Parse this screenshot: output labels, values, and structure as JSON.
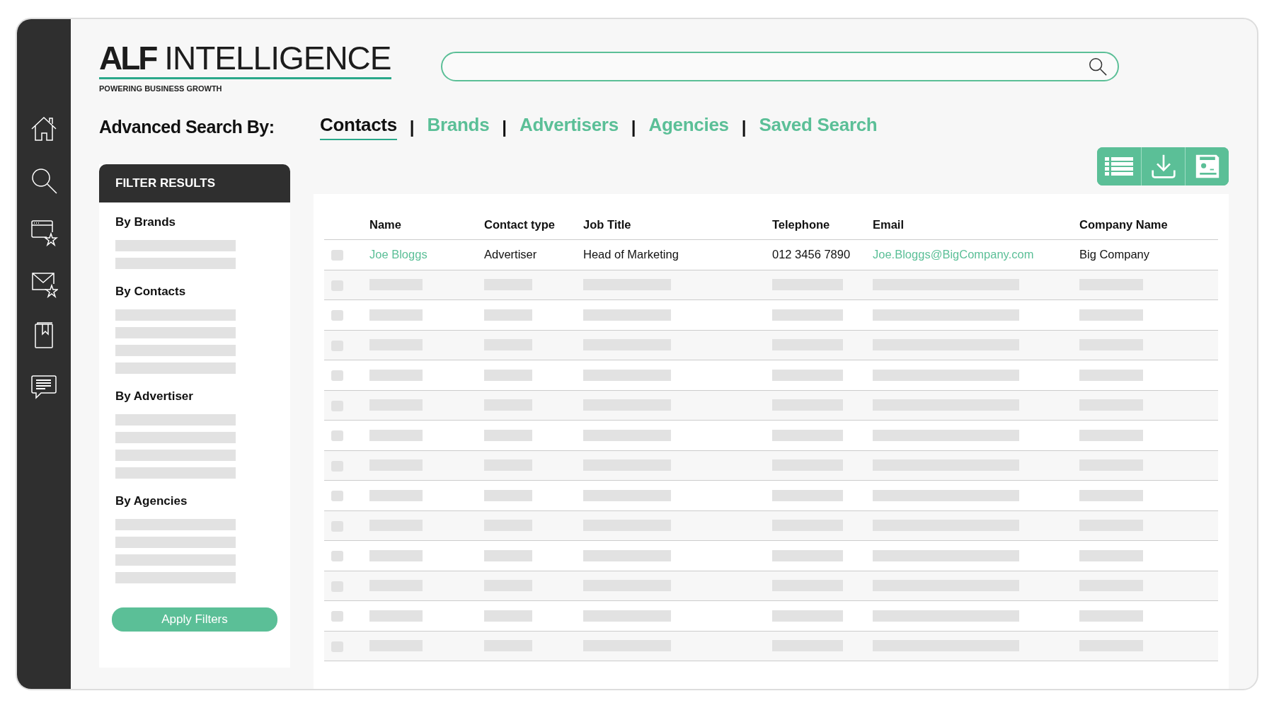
{
  "logo": {
    "brand_bold": "ALF",
    "brand_light": "INTELLIGENCE",
    "tagline": "POWERING BUSINESS GROWTH"
  },
  "advanced_search": {
    "label": "Advanced Search By:",
    "tabs": [
      {
        "label": "Contacts",
        "selected": true
      },
      {
        "label": "Brands",
        "selected": false
      },
      {
        "label": "Advertisers",
        "selected": false
      },
      {
        "label": "Agencies",
        "selected": false
      },
      {
        "label": "Saved Search",
        "selected": false
      }
    ],
    "separator": "|"
  },
  "filters": {
    "title": "FILTER RESULTS",
    "groups": [
      {
        "heading": "By Brands",
        "options": [
          {
            "kind": "placeholder"
          },
          {
            "kind": "placeholder"
          }
        ]
      },
      {
        "heading": "By Contacts",
        "options": [
          {
            "kind": "placeholder"
          },
          {
            "kind": "placeholder"
          },
          {
            "kind": "placeholder"
          },
          {
            "kind": "placeholder"
          }
        ]
      },
      {
        "heading": "By Advertiser",
        "options": [
          {
            "kind": "placeholder"
          },
          {
            "kind": "placeholder"
          },
          {
            "kind": "placeholder"
          },
          {
            "kind": "placeholder"
          }
        ]
      },
      {
        "heading": "By Agencies",
        "options": [
          {
            "kind": "placeholder"
          },
          {
            "kind": "placeholder"
          },
          {
            "kind": "placeholder"
          },
          {
            "kind": "placeholder"
          }
        ]
      }
    ],
    "apply_button": "Apply Filters"
  },
  "table": {
    "columns": [
      "Name",
      "Contact type",
      "Job Title",
      "Telephone",
      "Email",
      "Company Name"
    ],
    "rows": [
      {
        "kind": "contact",
        "checked": false,
        "name": "Joe Bloggs",
        "contact_type": "Advertiser",
        "job_title": "Head of Marketing",
        "telephone": "012 3456 7890",
        "email": "Joe.Bloggs@BigCompany.com",
        "company": "Big Company"
      },
      {
        "kind": "placeholder",
        "checked": false
      },
      {
        "kind": "placeholder",
        "checked": false
      },
      {
        "kind": "placeholder",
        "checked": false
      },
      {
        "kind": "placeholder",
        "checked": false
      },
      {
        "kind": "placeholder",
        "checked": false
      },
      {
        "kind": "placeholder",
        "checked": false
      },
      {
        "kind": "placeholder",
        "checked": false
      },
      {
        "kind": "placeholder",
        "checked": false
      },
      {
        "kind": "placeholder",
        "checked": false
      },
      {
        "kind": "placeholder",
        "checked": false
      },
      {
        "kind": "placeholder",
        "checked": false
      },
      {
        "kind": "placeholder",
        "checked": false
      },
      {
        "kind": "placeholder",
        "checked": false
      }
    ]
  }
}
